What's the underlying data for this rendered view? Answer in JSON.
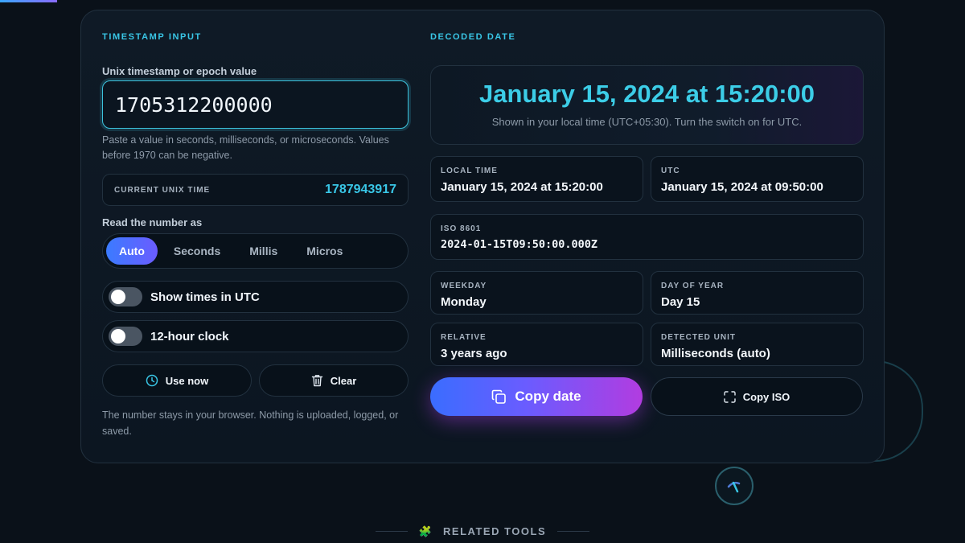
{
  "input_panel": {
    "title": "TIMESTAMP INPUT",
    "field_label": "Unix timestamp or epoch value",
    "timestamp_value": "1705312200000",
    "hint": "Paste a value in seconds, milliseconds, or microseconds. Values before 1970 can be negative.",
    "current_unix_label": "CURRENT UNIX TIME",
    "current_unix_value": "1787943917",
    "read_as_label": "Read the number as",
    "units": [
      "Auto",
      "Seconds",
      "Millis",
      "Micros"
    ],
    "selected_unit": "Auto",
    "toggle_utc": "Show times in UTC",
    "toggle_12h": "12-hour clock",
    "use_now": "Use now",
    "clear": "Clear",
    "privacy_note": "The number stays in your browser. Nothing is uploaded, logged, or saved."
  },
  "decoded_panel": {
    "title": "DECODED DATE",
    "hero_date": "January 15, 2024 at 15:20:00",
    "hero_sub": "Shown in your local time (UTC+05:30). Turn the switch on for UTC.",
    "local_label": "LOCAL TIME",
    "local_value": "January 15, 2024 at 15:20:00",
    "utc_label": "UTC",
    "utc_value": "January 15, 2024 at 09:50:00",
    "iso_label": "ISO 8601",
    "iso_value": "2024-01-15T09:50:00.000Z",
    "weekday_label": "WEEKDAY",
    "weekday_value": "Monday",
    "doy_label": "DAY OF YEAR",
    "doy_value": "Day 15",
    "relative_label": "RELATIVE",
    "relative_value": "3 years ago",
    "unit_label": "DETECTED UNIT",
    "unit_value": "Milliseconds (auto)",
    "copy_date": "Copy date",
    "copy_iso": "Copy ISO"
  },
  "footer": {
    "related_tools": "RELATED TOOLS",
    "related_icon": "🧩"
  },
  "colors": {
    "accent": "#39c6e6",
    "gradient_start": "#3a6dff",
    "gradient_end": "#b23ce0"
  }
}
